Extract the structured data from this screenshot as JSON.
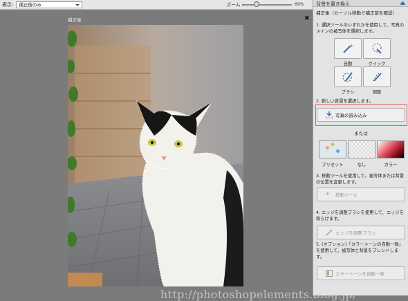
{
  "topbar": {
    "view_label": "表示:",
    "view_value": "補正後のみ",
    "zoom_label": "ズーム :",
    "zoom_value": "69%"
  },
  "canvas": {
    "caption": "補正後"
  },
  "panel": {
    "title": "背景を置き換え",
    "subtitle": "補正後（カーソル移動で補正前を確認）",
    "step1": "1. 選択ツールのいずれかを使用して、写真のメインの被写体を選択します。",
    "tools": [
      {
        "label": "自動",
        "icon": "magic-wand-icon"
      },
      {
        "label": "クイック",
        "icon": "quick-select-icon"
      },
      {
        "label": "ブラシ",
        "icon": "brush-select-icon"
      },
      {
        "label": "調整",
        "icon": "refine-brush-icon"
      }
    ],
    "step2": "2. 新しい背景を選択します。",
    "import_button": "写真の読み込み",
    "or_label": "または",
    "backgrounds": [
      {
        "label": "プリセット",
        "color": "#cfe0ea"
      },
      {
        "label": "なし",
        "color": "#eeeeee"
      },
      {
        "label": "カラー",
        "color": "#c8102e"
      }
    ],
    "step3": "3. 移動ツールを使用して、被写体または背景の位置を変更します。",
    "move_button": "移動ツール",
    "step4": "4. エッジを調整ブラシを使用して、エッジを和らげます。",
    "refine_button": "エッジを調整ブラシ",
    "step5": "5. (オプション)「カラートーンの自動一致」を使用して、被写体と背景をブレンドします。",
    "autotone_button": "カラートーンを自動一致"
  },
  "watermark": "http://photoshopelements.blog.jp/",
  "colors": {
    "panel_bg": "#e3e3e3",
    "highlight": "#e06060",
    "canvas_bg": "#7b7b7b"
  }
}
